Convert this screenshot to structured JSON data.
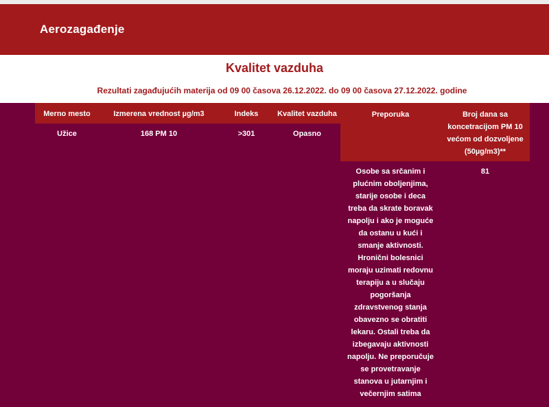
{
  "header": {
    "site_title": "Aerozagađenje"
  },
  "page": {
    "heading": "Kvalitet vazduha",
    "subheading": "Rezultati zagađujućih materija od 09 00 časova 26.12.2022. do 09 00 časova 27.12.2022. godine"
  },
  "table": {
    "columns": [
      "Merno mesto",
      "Izmerena vrednost µg/m3",
      "Indeks",
      "Kvalitet vazduha",
      "Preporuka",
      "Broj dana sa koncetracijom PM 10 većom od dozvoljene (50µg/m3)**"
    ],
    "row": {
      "location": "Užice",
      "value": "168 PM 10",
      "index": ">301",
      "quality": "Opasno",
      "recommendation": "Osobe sa srčanim i plućnim oboljenjima, starije osobe i deca treba da skrate boravak napolju i ako je moguće da ostanu u kući i smanje aktivnosti. Hronični bolesnici moraju uzimati redovnu terapiju a u slučaju pogoršanja zdravstvenog stanja obavezno se obratiti lekaru. Ostali treba da izbegavaju aktivnosti napolju. Ne preporučuje se provetravanje stanova u jutarnjim i večernjim satima",
      "days_over_limit": "81"
    }
  },
  "colors": {
    "header_red": "#a21a1c",
    "background_burgundy": "#720039",
    "white": "#ffffff"
  }
}
